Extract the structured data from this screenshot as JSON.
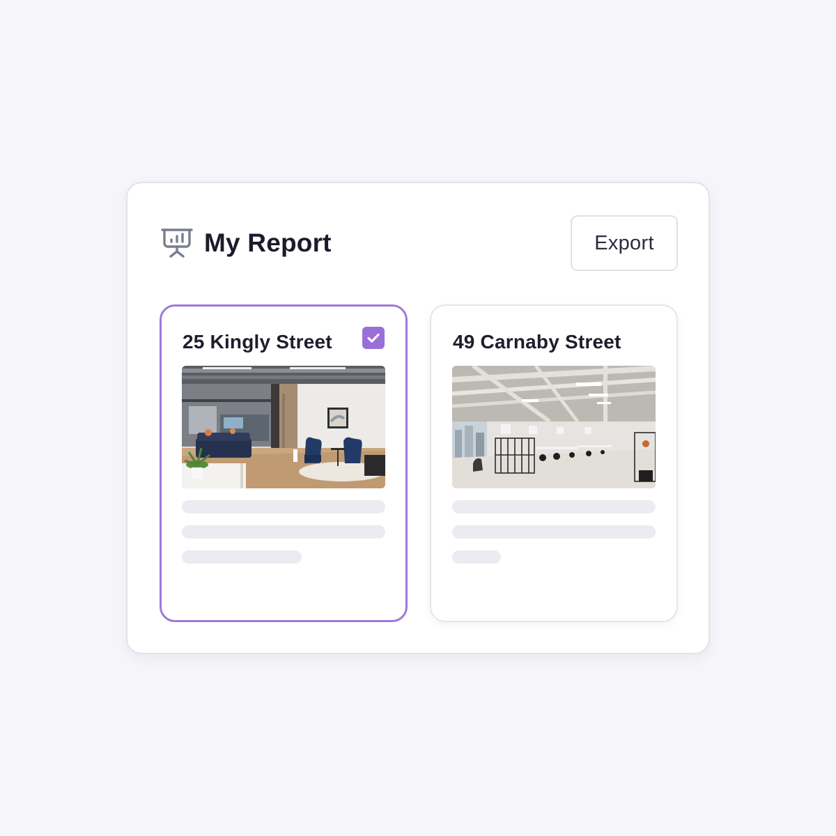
{
  "report": {
    "title": "My Report",
    "icon": "presentation-chart-icon",
    "export_label": "Export"
  },
  "colors": {
    "background": "#f6f5fa",
    "accent": "#9b6fd9",
    "selected_border": "#a177dc",
    "skeleton": "#ecebf1"
  },
  "properties": [
    {
      "name": "25 Kingly Street",
      "selected": true,
      "image": "office-lounge-photo"
    },
    {
      "name": "49 Carnaby Street",
      "selected": false,
      "image": "open-plan-office-photo"
    }
  ]
}
